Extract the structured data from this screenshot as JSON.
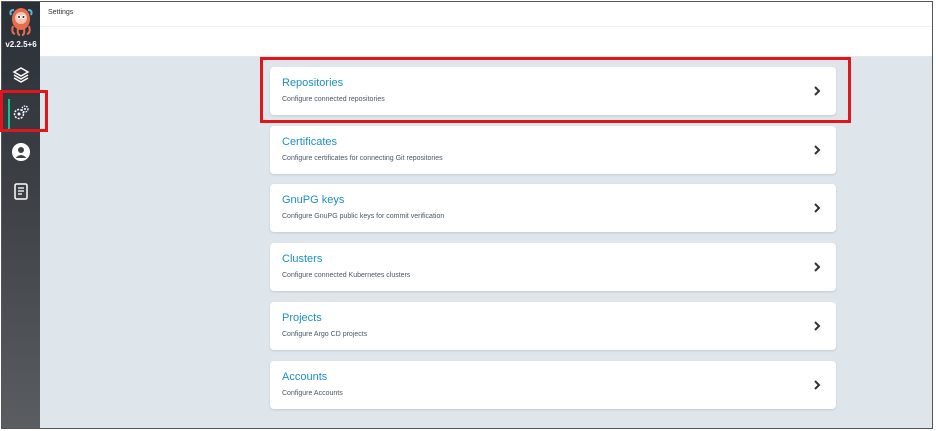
{
  "app": {
    "version": "v2.2.5+6",
    "page_title": "Settings"
  },
  "sidebar": {
    "items": [
      {
        "name": "applications",
        "icon": "layers-icon"
      },
      {
        "name": "settings",
        "icon": "gears-icon",
        "active": true
      },
      {
        "name": "user-info",
        "icon": "user-circle-icon"
      },
      {
        "name": "documentation",
        "icon": "book-icon"
      }
    ]
  },
  "settings": {
    "cards": [
      {
        "title": "Repositories",
        "description": "Configure connected repositories"
      },
      {
        "title": "Certificates",
        "description": "Configure certificates for connecting Git repositories"
      },
      {
        "title": "GnuPG keys",
        "description": "Configure GnuPG public keys for commit verification"
      },
      {
        "title": "Clusters",
        "description": "Configure connected Kubernetes clusters"
      },
      {
        "title": "Projects",
        "description": "Configure Argo CD projects"
      },
      {
        "title": "Accounts",
        "description": "Configure Accounts"
      }
    ]
  },
  "colors": {
    "accent": "#1c8fc0",
    "highlight": "#e0161d",
    "active_nav": "#18be94",
    "background": "#dee6eb"
  }
}
